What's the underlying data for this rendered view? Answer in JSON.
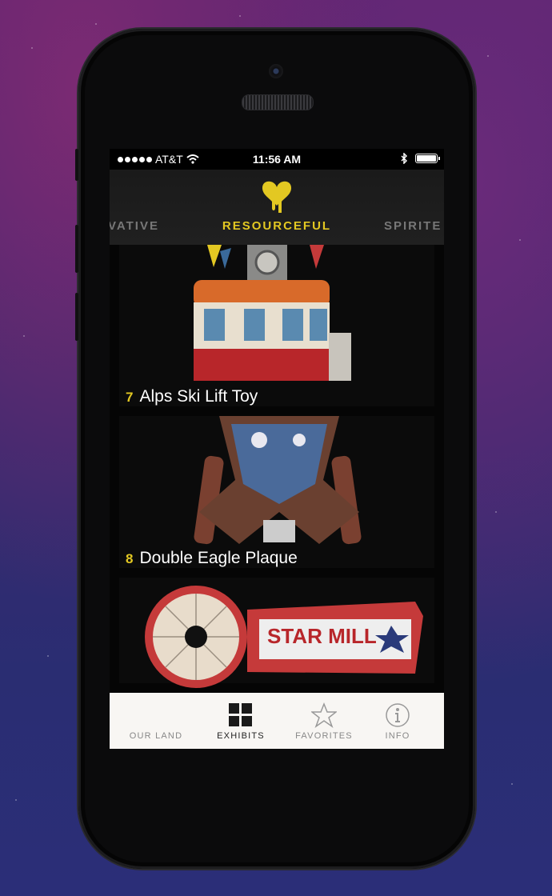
{
  "status_bar": {
    "carrier": "AT&T",
    "time": "11:56 AM"
  },
  "categories": {
    "prev": "VATIVE",
    "active": "RESOURCEFUL",
    "next": "SPIRITE"
  },
  "exhibits": [
    {
      "number": "7",
      "title": "Alps Ski Lift Toy"
    },
    {
      "number": "8",
      "title": "Double Eagle Plaque"
    },
    {
      "number": "",
      "title": ""
    }
  ],
  "tabs": [
    {
      "label": "OUR LAND",
      "icon": "map-icon"
    },
    {
      "label": "EXHIBITS",
      "icon": "grid-icon",
      "active": true
    },
    {
      "label": "FAVORITES",
      "icon": "star-icon"
    },
    {
      "label": "INFO",
      "icon": "info-icon"
    }
  ],
  "colors": {
    "accent": "#e3c822",
    "tabbar_bg": "#f8f6f3"
  }
}
